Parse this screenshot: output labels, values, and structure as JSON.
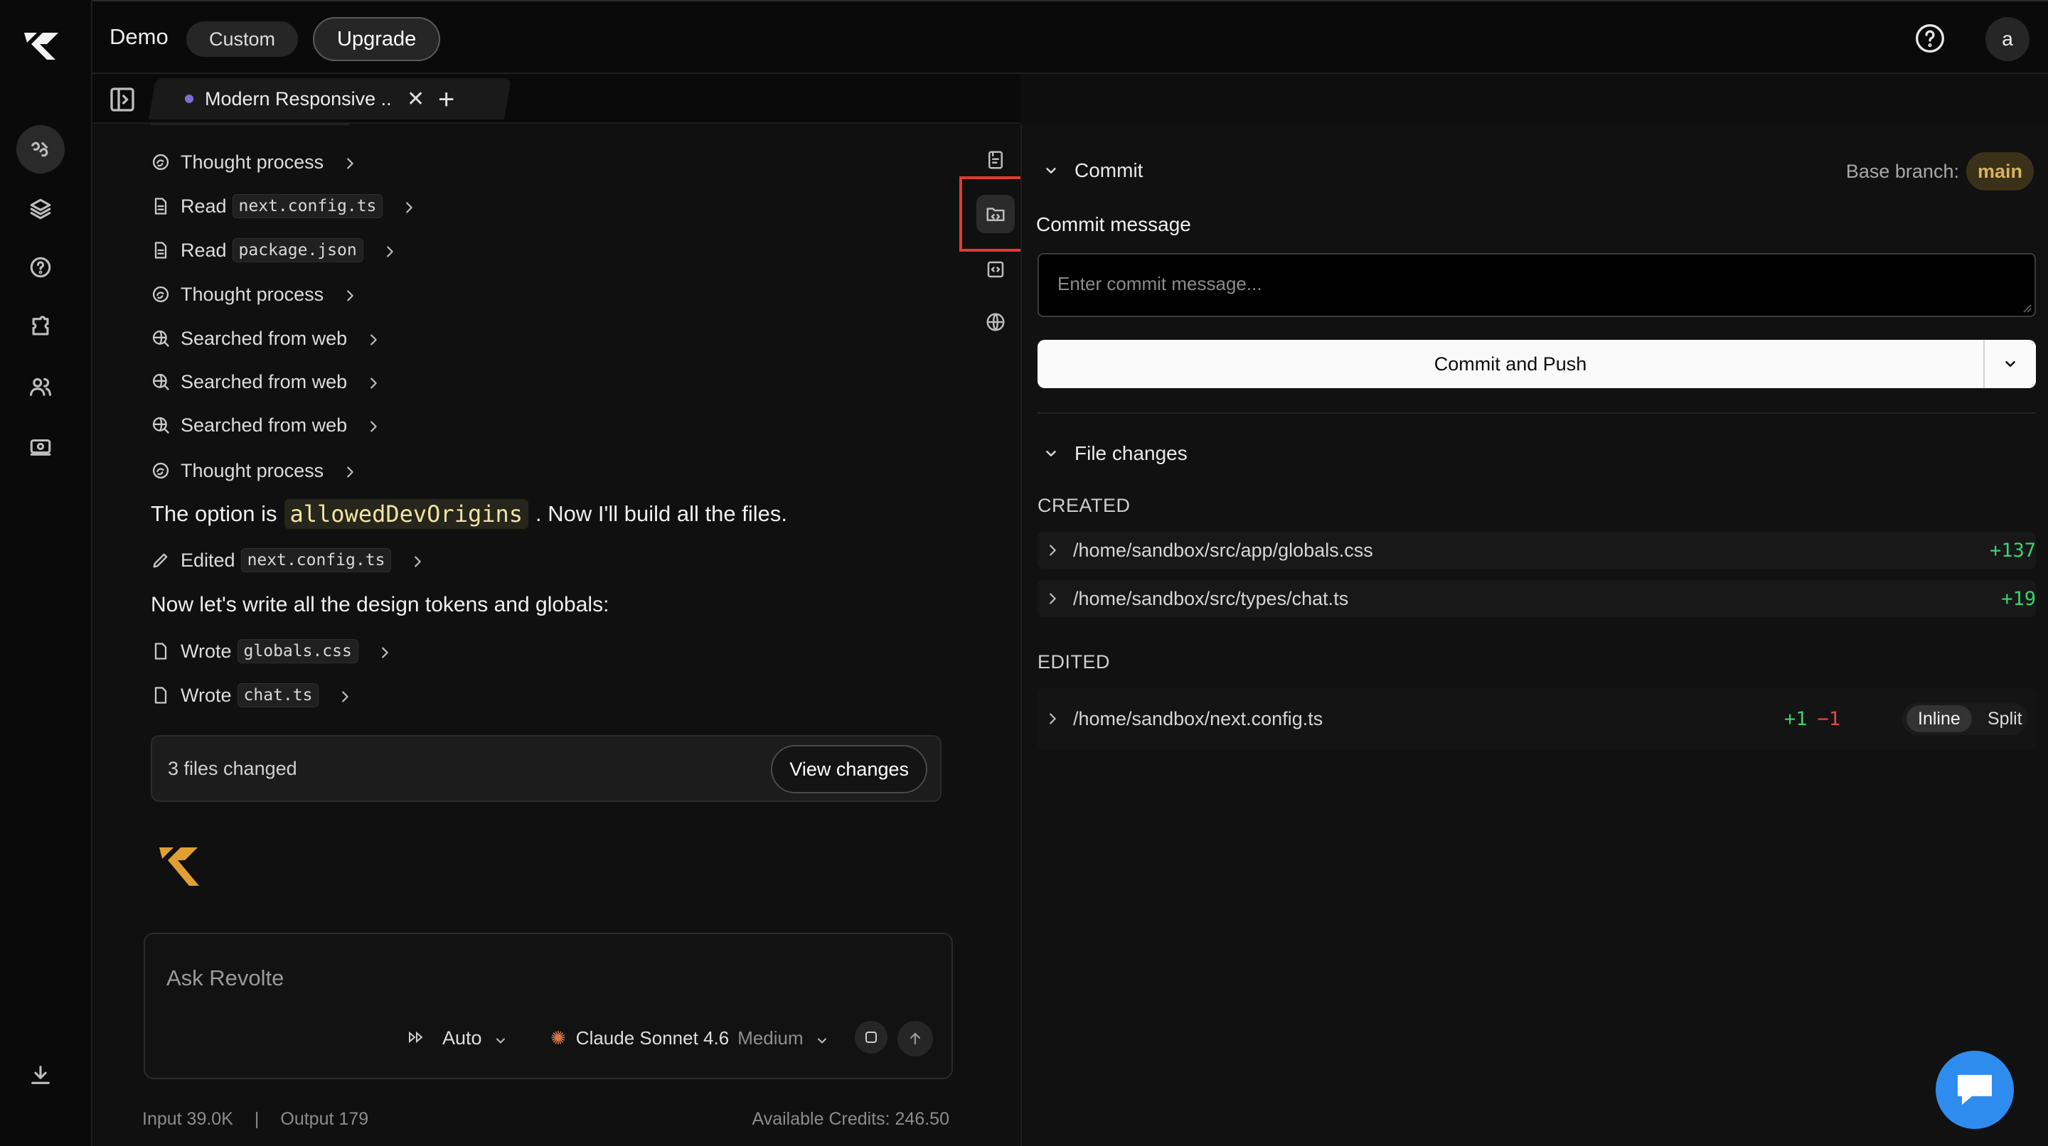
{
  "app": {
    "project_name": "Demo",
    "plan_badge": "Custom",
    "upgrade_label": "Upgrade",
    "avatar_initial": "a"
  },
  "rail": {
    "icons": [
      "brand-logo",
      "chat-icon",
      "layers-icon",
      "help-circle-icon",
      "puzzle-icon",
      "users-icon",
      "billing-icon",
      "download-icon"
    ]
  },
  "tabs": {
    "active_title": "Modern Responsive ...",
    "close_glyph": "✕",
    "add_glyph": "+"
  },
  "chat": {
    "steps": [
      {
        "kind": "thought",
        "label": "Thought process",
        "code": ""
      },
      {
        "kind": "read",
        "label": "Read",
        "code": "next.config.ts"
      },
      {
        "kind": "read",
        "label": "Read",
        "code": "package.json"
      },
      {
        "kind": "thought",
        "label": "Thought process",
        "code": ""
      },
      {
        "kind": "web",
        "label": "Searched from web",
        "code": ""
      },
      {
        "kind": "web",
        "label": "Searched from web",
        "code": ""
      },
      {
        "kind": "web",
        "label": "Searched from web",
        "code": ""
      },
      {
        "kind": "thought",
        "label": "Thought process",
        "code": ""
      }
    ],
    "message_1": {
      "prefix": "The option is",
      "code": "allowedDevOrigins",
      "suffix": ". Now I'll build all the files."
    },
    "edited_step": {
      "label": "Edited",
      "code": "next.config.ts"
    },
    "message_2": "Now let's write all the design tokens and globals:",
    "wrote_steps": [
      {
        "label": "Wrote",
        "code": "globals.css"
      },
      {
        "label": "Wrote",
        "code": "chat.ts"
      }
    ],
    "changes_summary": "3 files changed",
    "view_changes_label": "View changes",
    "input_placeholder": "Ask Revolte",
    "mode": "Auto",
    "model_name": "Claude Sonnet 4.6",
    "model_effort": "Medium",
    "input_tokens": "Input 39.0K",
    "separator": "|",
    "output_tokens": "Output 179",
    "credits": "Available Credits: 246.50"
  },
  "tools": {
    "icons": [
      "file-text-icon",
      "folder-code-icon",
      "code-icon",
      "globe-icon"
    ],
    "active": "folder-code-icon"
  },
  "commit_panel": {
    "section_title": "Commit",
    "base_branch_label": "Base branch:",
    "base_branch": "main",
    "commit_message_label": "Commit message",
    "commit_message_placeholder": "Enter commit message...",
    "commit_button_label": "Commit and Push",
    "file_changes_title": "File changes",
    "created_label": "CREATED",
    "created_files": [
      {
        "path": "/home/sandbox/src/app/globals.css",
        "additions": "+137"
      },
      {
        "path": "/home/sandbox/src/types/chat.ts",
        "additions": "+19"
      }
    ],
    "edited_label": "EDITED",
    "edited_files": [
      {
        "path": "/home/sandbox/next.config.ts",
        "additions": "+1",
        "deletions": "−1"
      }
    ],
    "view_modes": [
      "Inline",
      "Split"
    ],
    "active_view_mode": "Inline"
  },
  "colors": {
    "accent_gold": "#d9b35b",
    "brand_orange": "#e0a030",
    "add_green": "#3ecf72",
    "del_red": "#e5484d",
    "highlight_red": "#e03b2e",
    "chat_widget_blue": "#2f8cef"
  }
}
